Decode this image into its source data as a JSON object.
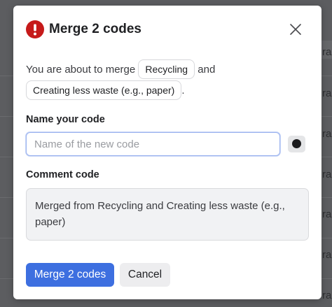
{
  "background": {
    "row_fragments": [
      "ra",
      "ra",
      "ra",
      "ra",
      "ra",
      "ra",
      "ra",
      "a"
    ]
  },
  "dialog": {
    "icon": "exclamation-circle-icon",
    "title": "Merge 2 codes",
    "close_icon": "close-icon"
  },
  "intro": {
    "prefix": "You are about to merge",
    "code_a": "Recycling",
    "joiner": "and",
    "code_b": "Creating less waste (e.g., paper)",
    "suffix": "."
  },
  "name_field": {
    "label": "Name your code",
    "placeholder": "Name of the new code",
    "value": "",
    "color_button_icon": "color-dot-icon"
  },
  "comment_field": {
    "label": "Comment code",
    "value": "Merged from Recycling and Creating less waste (e.g., paper)"
  },
  "actions": {
    "primary_label": "Merge 2 codes",
    "secondary_label": "Cancel"
  },
  "colors": {
    "primary": "#3d6fe0",
    "alert": "#c61a1a",
    "overlay": "#5f6062"
  }
}
